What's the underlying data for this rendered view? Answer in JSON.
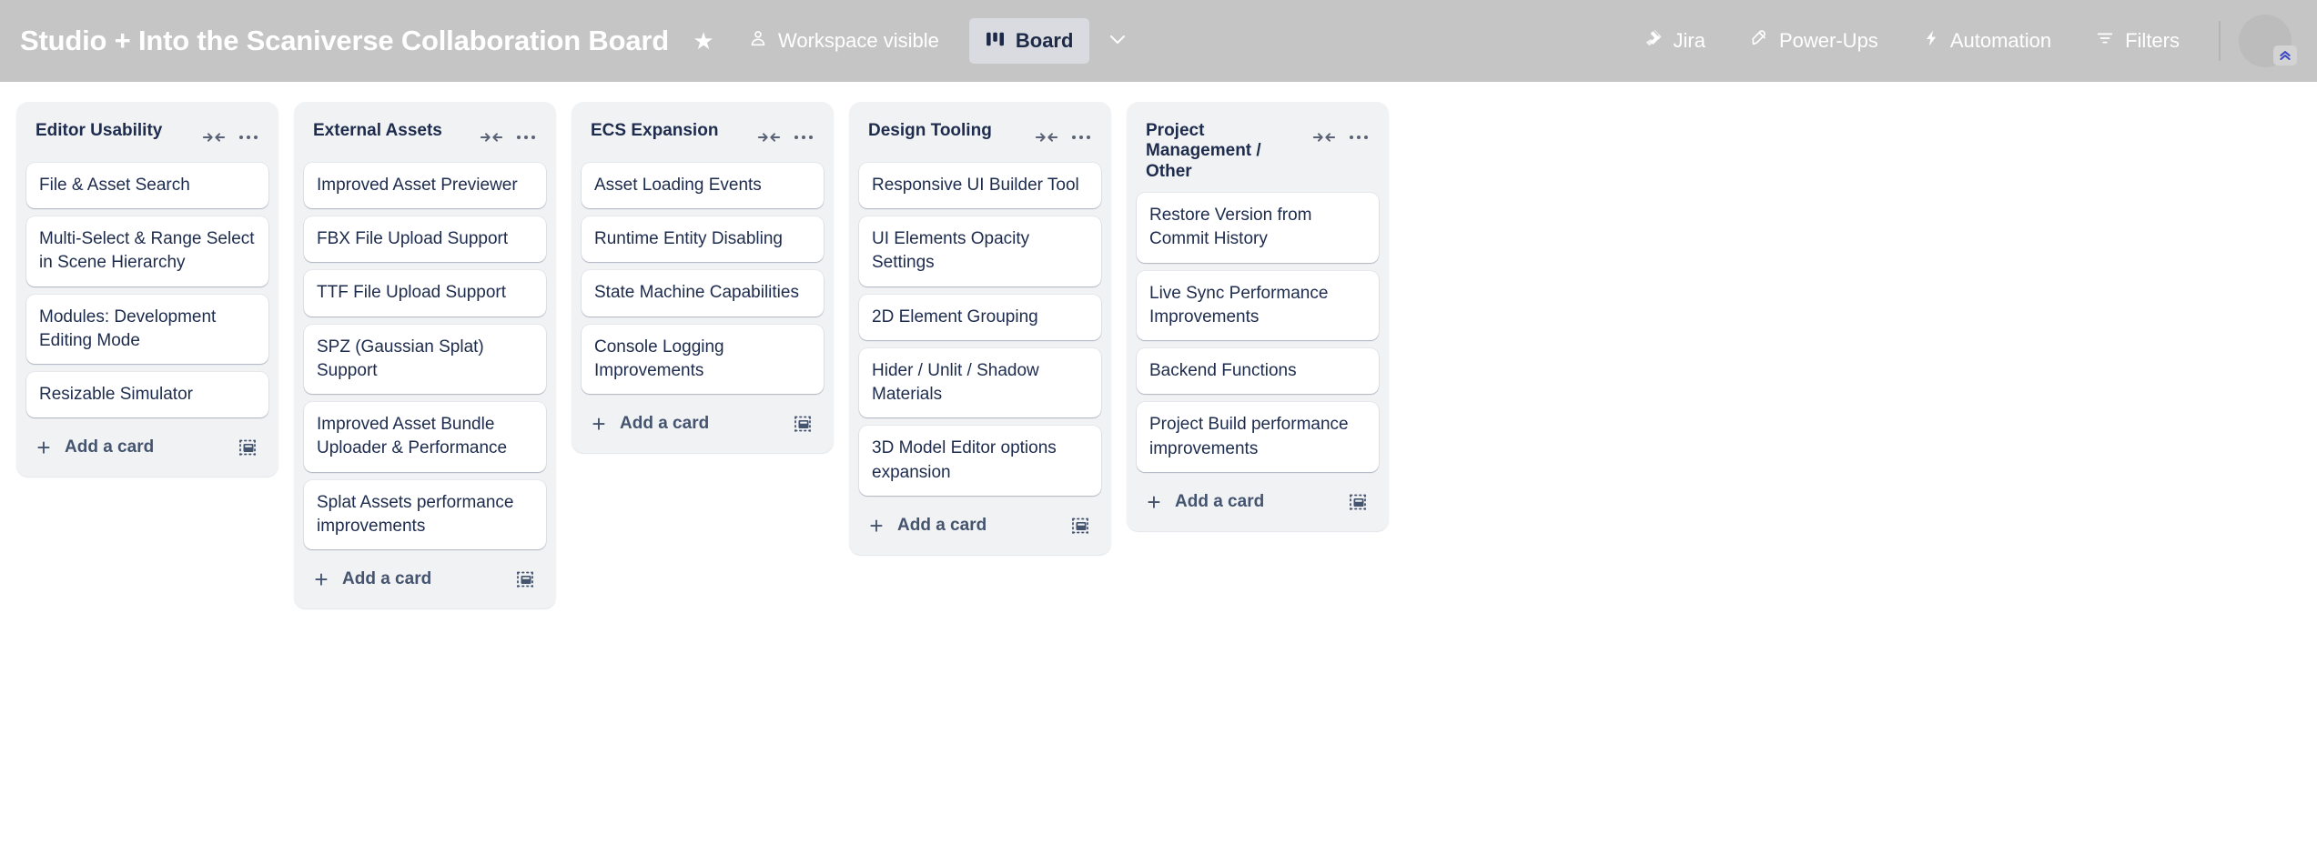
{
  "header": {
    "board_title": "Studio + Into the Scaniverse Collaboration Board",
    "star_icon": "star-icon",
    "visibility_label": "Workspace visible",
    "visibility_icon": "workspace-visible-icon",
    "view_label": "Board",
    "view_icon": "board-view-icon",
    "view_chevron_icon": "chevron-down-icon",
    "actions": [
      {
        "label": "Jira",
        "icon": "jira-icon"
      },
      {
        "label": "Power-Ups",
        "icon": "rocket-icon"
      },
      {
        "label": "Automation",
        "icon": "lightning-bolt-icon"
      },
      {
        "label": "Filters",
        "icon": "filter-icon"
      }
    ],
    "avatar_icon": "avatar",
    "avatar_badge_icon": "double-chevron-up-icon",
    "colors": {
      "bar_background": "#c5c5c6",
      "text": "#ffffff",
      "chip_background": "#d9dbe0",
      "chip_text": "#1d2a47"
    }
  },
  "board": {
    "add_card_label": "Add a card",
    "add_card_icon": "plus-icon",
    "card_template_icon": "card-template-icon",
    "collapse_icon": "collapse-list-icon",
    "more_icon": "list-actions-icon",
    "colors": {
      "list_background": "#f1f2f4",
      "card_background": "#ffffff",
      "text": "#1d2b4d",
      "muted_text": "#44546f"
    },
    "lists": [
      {
        "title": "Editor Usability",
        "cards": [
          "File & Asset Search",
          "Multi-Select & Range Select in Scene Hierarchy",
          "Modules: Development Editing Mode",
          "Resizable Simulator"
        ]
      },
      {
        "title": "External Assets",
        "cards": [
          "Improved Asset Previewer",
          "FBX File Upload Support",
          "TTF File Upload Support",
          "SPZ (Gaussian Splat) Support",
          "Improved Asset Bundle Uploader & Performance",
          "Splat Assets performance improvements"
        ]
      },
      {
        "title": "ECS Expansion",
        "cards": [
          "Asset Loading Events",
          "Runtime Entity Disabling",
          "State Machine Capabilities",
          "Console Logging Improvements"
        ]
      },
      {
        "title": "Design Tooling",
        "cards": [
          "Responsive UI Builder Tool",
          "UI Elements Opacity Settings",
          "2D Element Grouping",
          "Hider / Unlit / Shadow Materials",
          "3D Model Editor options expansion"
        ]
      },
      {
        "title": "Project Management / Other",
        "cards": [
          "Restore Version from Commit History",
          "Live Sync Performance Improvements",
          "Backend Functions",
          "Project Build performance improvements"
        ]
      }
    ]
  }
}
